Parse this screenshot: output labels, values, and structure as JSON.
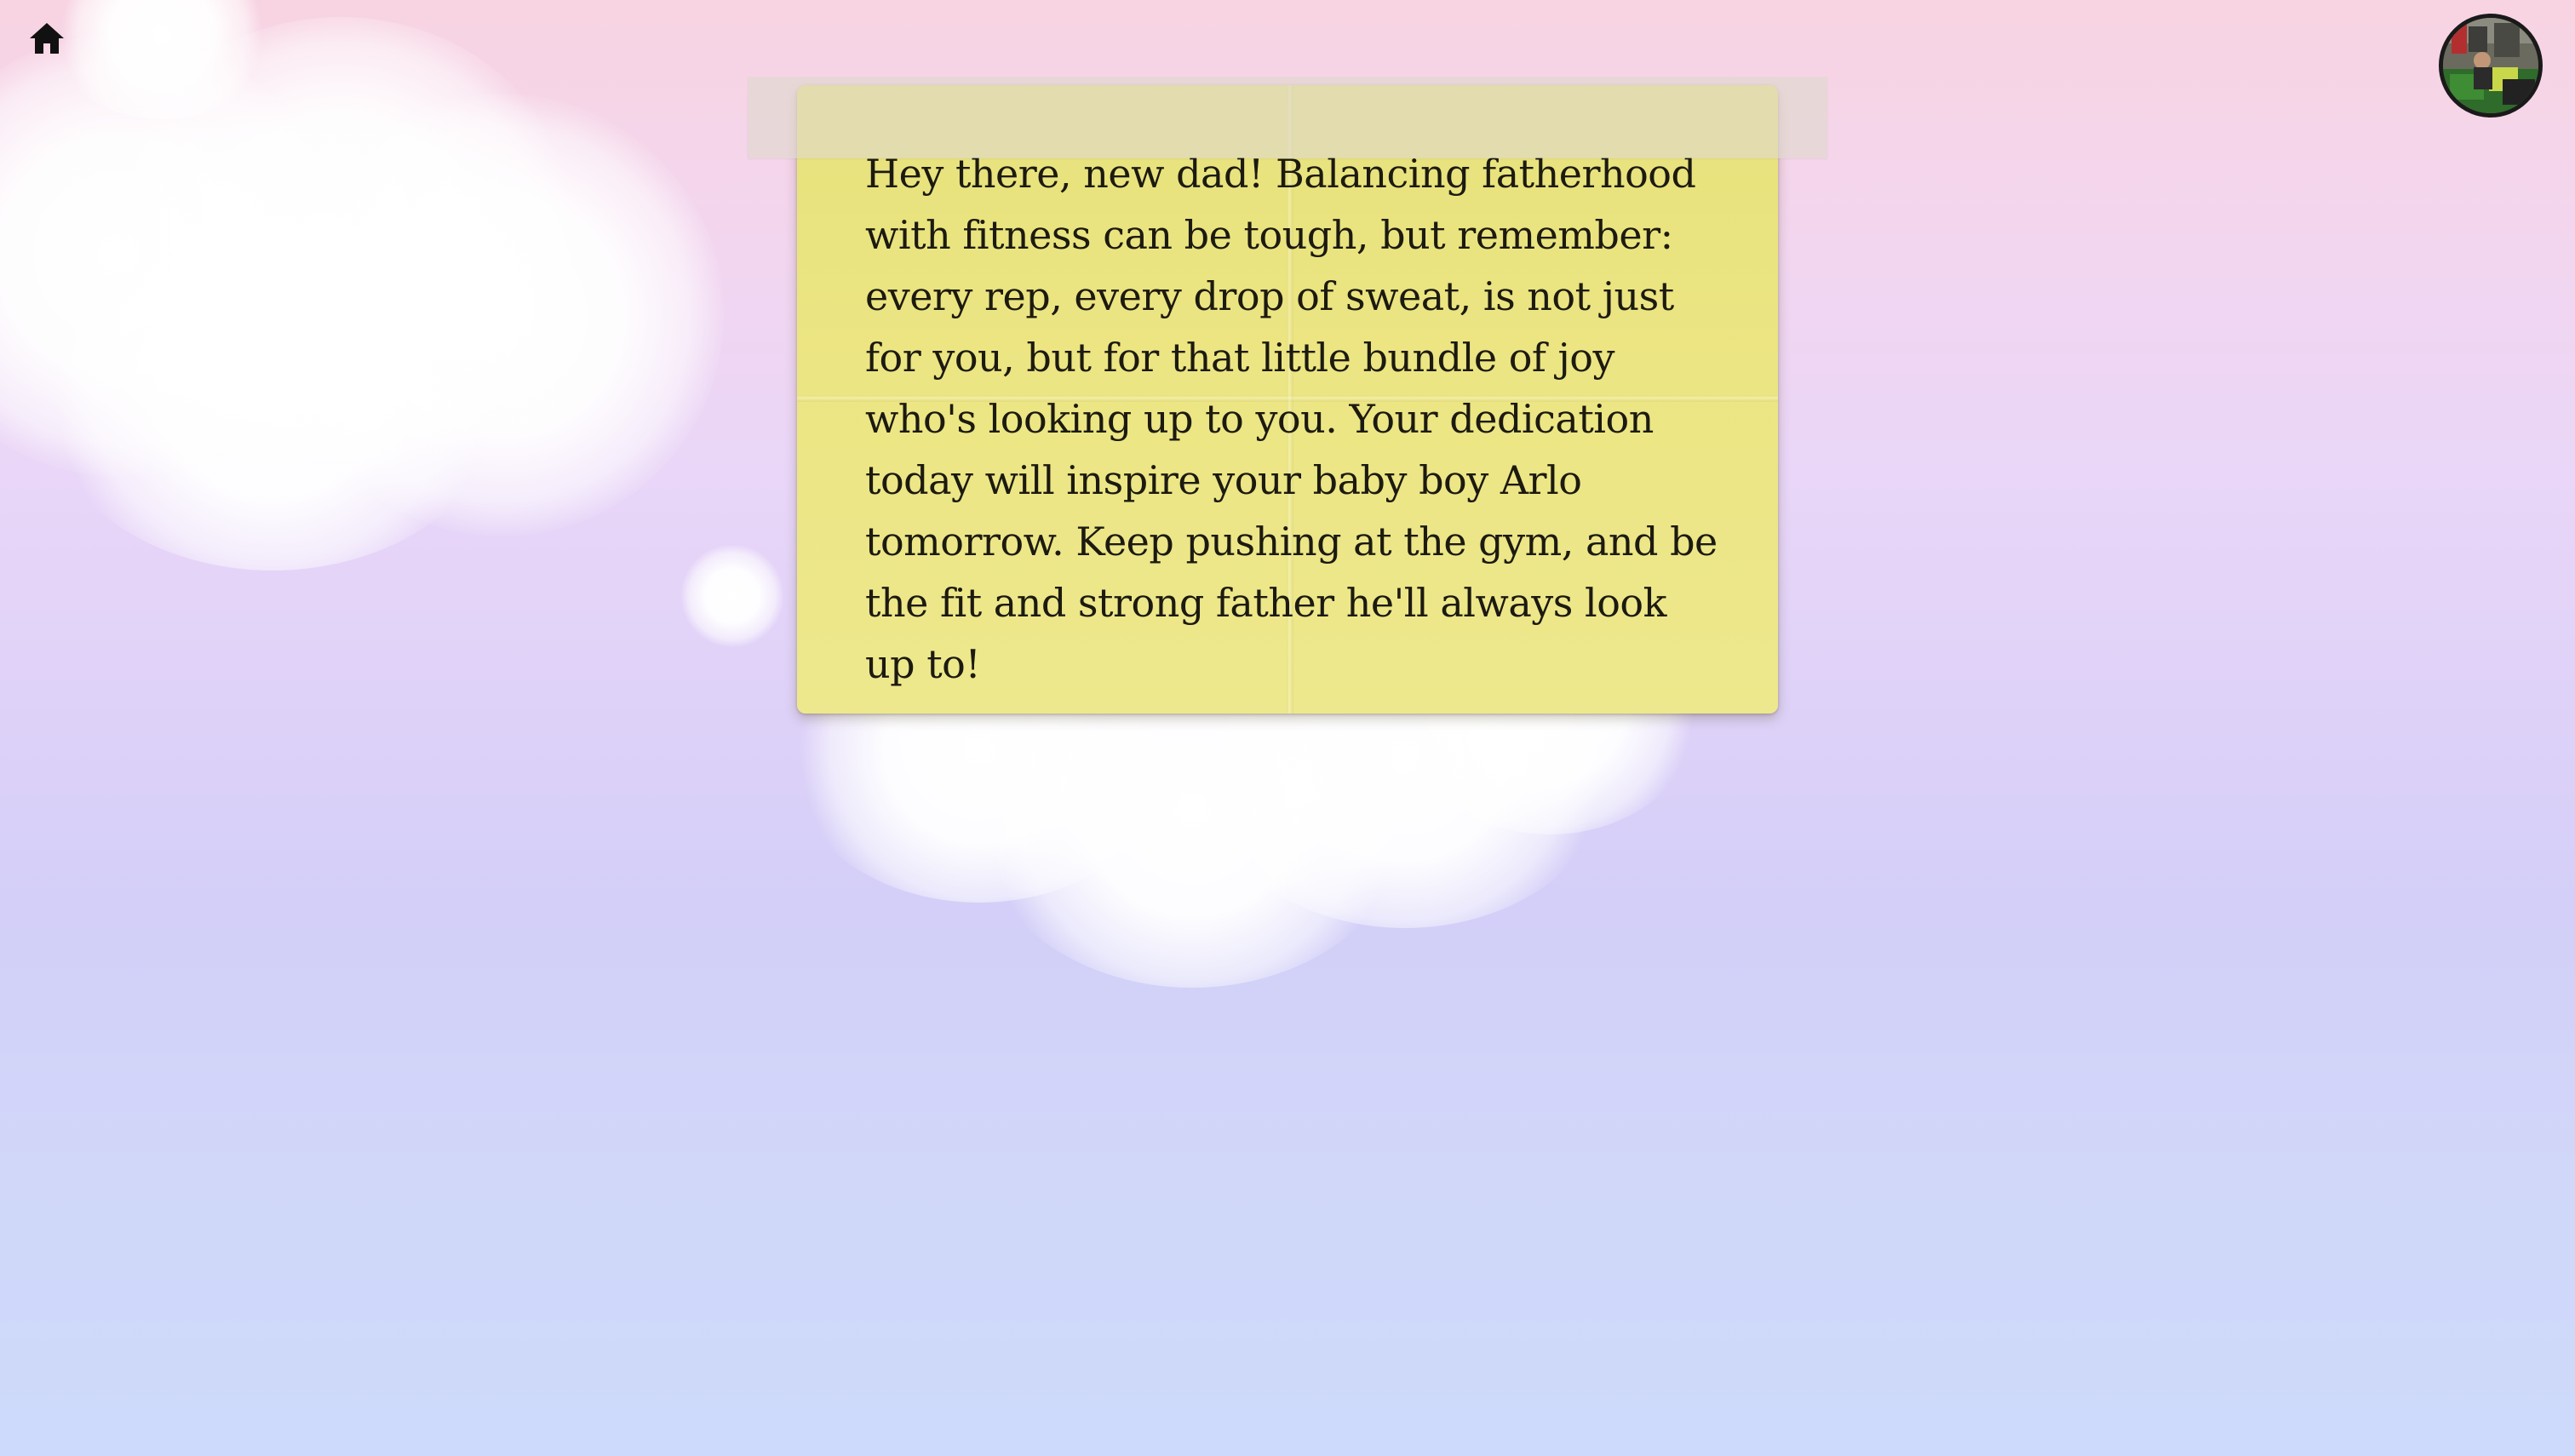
{
  "navigation": {
    "home_icon": "home-icon"
  },
  "profile": {
    "avatar_icon": "avatar-photo"
  },
  "note": {
    "message": "Hey there, new dad! Balancing fatherhood with fitness can be tough, but remember: every rep, every drop of sweat, is not just for you, but for that little bundle of joy who's looking up to you. Your dedication today will inspire your baby boy Arlo tomorrow. Keep pushing at the gym, and be the fit and strong father he'll always look up to!",
    "color": "#ece583"
  },
  "theme": {
    "background_top": "#f8d4e2",
    "background_middle": "#ddd1f8",
    "background_bottom": "#cddafb",
    "tape_color": "#ded8cd"
  }
}
